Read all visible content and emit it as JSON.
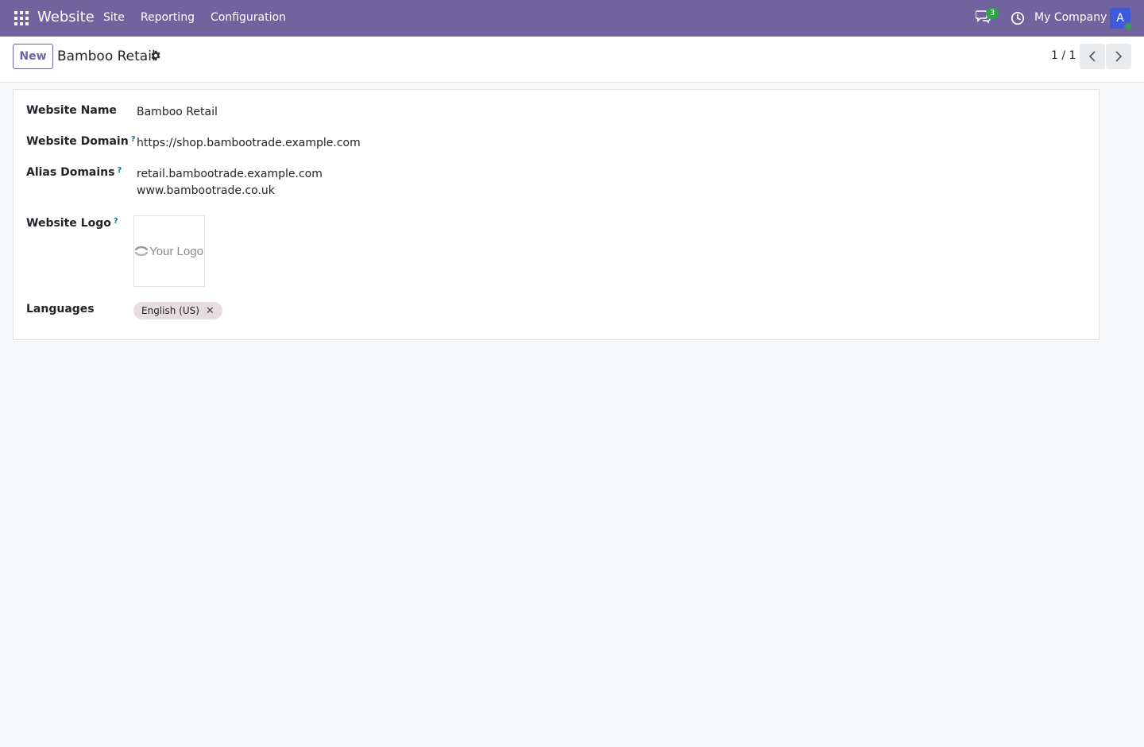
{
  "navbar": {
    "brand": "Website",
    "menu": [
      "Site",
      "Reporting",
      "Configuration"
    ],
    "chat_count": "3",
    "company": "My Company",
    "avatar_letter": "A",
    "color": "#71639e"
  },
  "control_panel": {
    "new_label": "New",
    "title": "Bamboo Retail",
    "pager": "1 / 1"
  },
  "form": {
    "website_name": {
      "label": "Website Name",
      "value": "Bamboo Retail"
    },
    "website_domain": {
      "label": "Website Domain",
      "help": "?",
      "value": "https://shop.bambootrade.example.com"
    },
    "alias_domains": {
      "label": "Alias Domains",
      "help": "?",
      "values": [
        "retail.bambootrade.example.com",
        "www.bambootrade.co.uk"
      ]
    },
    "website_logo": {
      "label": "Website Logo",
      "help": "?",
      "logo_text": "Your Logo"
    },
    "languages": {
      "label": "Languages",
      "tags": [
        "English (US)"
      ],
      "remove_glyph": "✕"
    }
  },
  "icons": {
    "apps": "apps-grid-icon",
    "chat": "chat-icon",
    "activity": "clock-icon",
    "settings": "gear-icon",
    "prev": "chevron-left-icon",
    "next": "chevron-right-icon"
  }
}
